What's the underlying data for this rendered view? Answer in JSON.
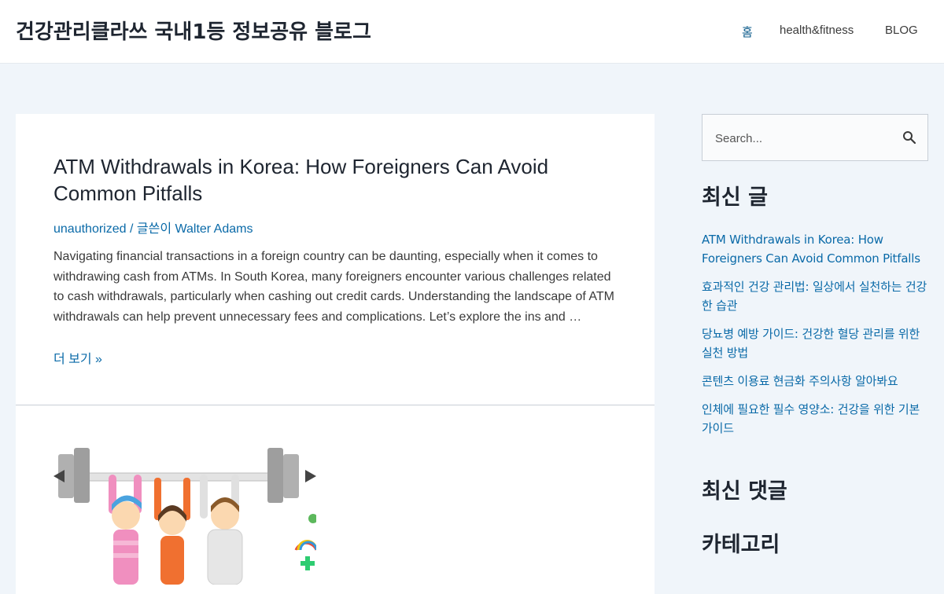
{
  "header": {
    "site_title": "건강관리클라쓰 국내1등 정보공유 블로그",
    "nav": [
      {
        "label": "홈"
      },
      {
        "label": "health&fitness"
      },
      {
        "label": "BLOG"
      }
    ]
  },
  "post": {
    "title": "ATM Withdrawals in Korea: How Foreigners Can Avoid Common Pitfalls",
    "category": "unauthorized",
    "meta_separator": "/",
    "author": "글쓴이 Walter Adams",
    "excerpt": "Navigating financial transactions in a foreign country can be daunting, especially when it comes to withdrawing cash from ATMs. In South Korea, many foreigners encounter various challenges related to cash withdrawals, particularly when cashing out credit cards. Understanding the landscape of ATM withdrawals can help prevent unnecessary fees and complications.  Let’s explore the ins and …",
    "read_more": "더 보기 »"
  },
  "sidebar": {
    "search": {
      "placeholder": "Search..."
    },
    "recent_posts_title": "최신 글",
    "recent_posts": [
      "ATM Withdrawals in Korea: How Foreigners Can Avoid Common Pitfalls",
      "효과적인 건강 관리법: 일상에서 실천하는 건강한 습관",
      "당뇨병 예방 가이드: 건강한 혈당 관리를 위한 실천 방법",
      "콘텐츠 이용료 현금화 주의사항 알아봐요",
      "인체에 필요한 필수 영양소: 건강을 위한 기본 가이드"
    ],
    "recent_comments_title": "최신 댓글",
    "categories_title": "카테고리"
  },
  "colors": {
    "background": "#f0f5fa",
    "link": "#0a6aa8",
    "heading": "#1e2530"
  }
}
